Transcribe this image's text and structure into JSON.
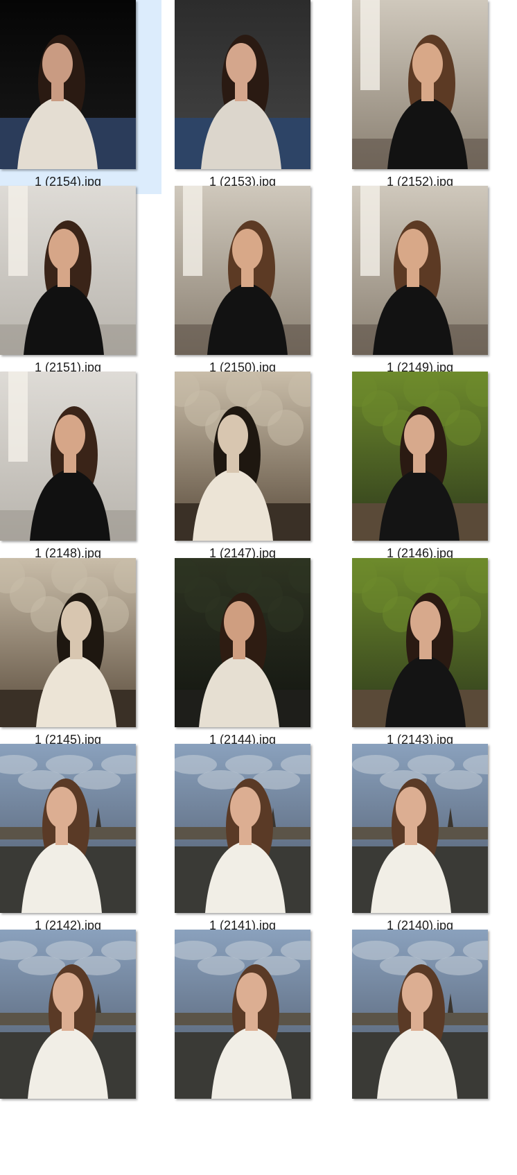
{
  "files": [
    {
      "name": "1 (2154).jpg",
      "selected": true,
      "scene": "studio-dark"
    },
    {
      "name": "1 (2153).jpg",
      "selected": false,
      "scene": "studio-grey"
    },
    {
      "name": "1 (2152).jpg",
      "selected": false,
      "scene": "window-warm"
    },
    {
      "name": "1 (2151).jpg",
      "selected": false,
      "scene": "mirror-light"
    },
    {
      "name": "1 (2150).jpg",
      "selected": false,
      "scene": "window-warm"
    },
    {
      "name": "1 (2149).jpg",
      "selected": false,
      "scene": "window-warm"
    },
    {
      "name": "1 (2148).jpg",
      "selected": false,
      "scene": "mirror-light"
    },
    {
      "name": "1 (2147).jpg",
      "selected": false,
      "scene": "sepia"
    },
    {
      "name": "1 (2146).jpg",
      "selected": false,
      "scene": "forest"
    },
    {
      "name": "1 (2145).jpg",
      "selected": false,
      "scene": "sepia"
    },
    {
      "name": "1 (2144).jpg",
      "selected": false,
      "scene": "forest-dark"
    },
    {
      "name": "1 (2143).jpg",
      "selected": false,
      "scene": "forest"
    },
    {
      "name": "1 (2142).jpg",
      "selected": false,
      "scene": "sky"
    },
    {
      "name": "1 (2141).jpg",
      "selected": false,
      "scene": "sky"
    },
    {
      "name": "1 (2140).jpg",
      "selected": false,
      "scene": "sky"
    },
    {
      "name": "",
      "selected": false,
      "scene": "sky"
    },
    {
      "name": "",
      "selected": false,
      "scene": "sky"
    },
    {
      "name": "",
      "selected": false,
      "scene": "sky"
    }
  ],
  "scenes": {
    "studio-dark": {
      "bg1": "#050505",
      "bg2": "#1a1a1a",
      "ground": "#2b3c5a",
      "skin": "#c99b82",
      "hair": "#2a1a12",
      "top": "#e4ddd2"
    },
    "studio-grey": {
      "bg1": "#2c2c2c",
      "bg2": "#454545",
      "ground": "#2d4466",
      "skin": "#d4a68c",
      "hair": "#2a1a12",
      "top": "#dcd6cc"
    },
    "window-warm": {
      "bg1": "#cfc8bc",
      "bg2": "#8a8072",
      "ground": "#5e5247",
      "skin": "#d8a888",
      "hair": "#5c3a24",
      "top": "#121212"
    },
    "mirror-light": {
      "bg1": "#dedbd6",
      "bg2": "#b8b4ad",
      "ground": "#9c9890",
      "skin": "#d6a688",
      "hair": "#3a2418",
      "top": "#111111"
    },
    "sepia": {
      "bg1": "#c9bda9",
      "bg2": "#5a4c3c",
      "ground": "#3a3026",
      "skin": "#d8c6b0",
      "hair": "#1e1710",
      "top": "#ece4d6"
    },
    "forest": {
      "bg1": "#6e8b2c",
      "bg2": "#2e3a1c",
      "ground": "#5a4a38",
      "skin": "#d7a98c",
      "hair": "#2a1a12",
      "top": "#141414"
    },
    "forest-dark": {
      "bg1": "#2e3422",
      "bg2": "#121410",
      "ground": "#1e1e1a",
      "skin": "#cf9e80",
      "hair": "#2e1c12",
      "top": "#e6dfd2"
    },
    "sky": {
      "bg1": "#8aa1bd",
      "bg2": "#4b5566",
      "ground": "#3a3a36",
      "skin": "#dcae92",
      "hair": "#5a3a26",
      "top": "#f1eee6"
    }
  }
}
